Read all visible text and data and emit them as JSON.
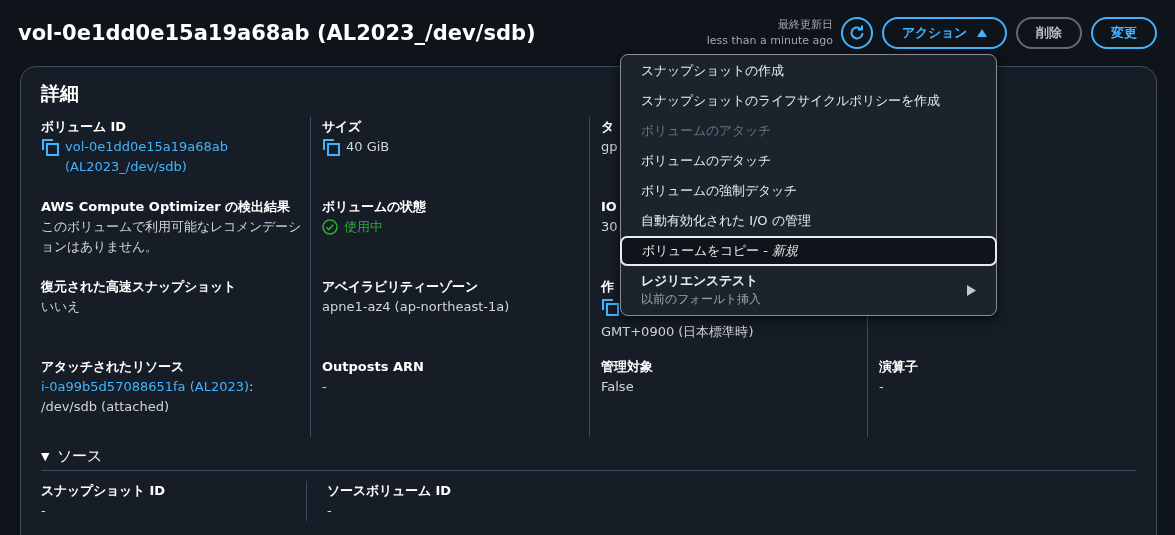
{
  "header": {
    "title": "vol-0e1dd0e15a19a68ab (AL2023_/dev/sdb)",
    "last_updated_label": "最終更新日",
    "last_updated_value": "less than a minute ago",
    "buttons": [
      {
        "label": "アクション",
        "kind": "dropdown",
        "expanded": true
      },
      {
        "label": "削除",
        "kind": "normal"
      },
      {
        "label": "変更",
        "kind": "primary"
      }
    ]
  },
  "details": {
    "heading": "詳細",
    "cells": [
      {
        "label": "ボリューム ID",
        "kind": "copy-link",
        "value": "vol-0e1dd0e15a19a68ab (AL2023_/dev/sdb)"
      },
      {
        "label": "サイズ",
        "kind": "copy-text",
        "value": "40 GiB"
      },
      {
        "label": "タ",
        "kind": "text",
        "value": "gp"
      },
      {
        "kind": "empty"
      },
      {
        "label": "AWS Compute Optimizer の検出結果",
        "kind": "text",
        "value": "このボリュームで利用可能なレコメンデーションはありません。"
      },
      {
        "label": "ボリュームの状態",
        "kind": "status",
        "value": "使用中"
      },
      {
        "label": "IO",
        "kind": "text",
        "value": "30"
      },
      {
        "kind": "empty"
      },
      {
        "label": "復元された高速スナップショット",
        "kind": "text",
        "value": "いいえ"
      },
      {
        "label": "アベイラビリティーゾーン",
        "kind": "text",
        "value": "apne1-az4 (ap-northeast-1a)"
      },
      {
        "label": "作",
        "kind": "copy-wrap",
        "value": "GMT+0900 (日本標準時)"
      },
      {
        "kind": "empty"
      },
      {
        "label": "アタッチされたリソース",
        "kind": "link-rest",
        "value": "i-0a99b5d57088651fa (AL2023)",
        "rest": ":",
        "rest2": "/dev/sdb (attached)"
      },
      {
        "label": "Outposts ARN",
        "kind": "text",
        "value": "-"
      },
      {
        "label": "管理対象",
        "kind": "text",
        "value": "False"
      },
      {
        "label": "演算子",
        "kind": "text",
        "value": "-"
      }
    ]
  },
  "source": {
    "toggle": "▼",
    "heading": "ソース",
    "expanded": true,
    "cells": [
      {
        "label": "スナップショット ID",
        "value": "-"
      },
      {
        "label": "ソースボリューム ID",
        "value": "-"
      }
    ]
  },
  "menu": {
    "items": [
      {
        "label": "スナップショットの作成",
        "kind": "item",
        "disabled": false,
        "selected": false
      },
      {
        "label": "スナップショットのライフサイクルポリシーを作成",
        "kind": "item",
        "disabled": false,
        "selected": false
      },
      {
        "label": "ボリュームのアタッチ",
        "kind": "item",
        "disabled": true,
        "selected": false
      },
      {
        "label": "ボリュームのデタッチ",
        "kind": "item",
        "disabled": false,
        "selected": false
      },
      {
        "label": "ボリュームの強制デタッチ",
        "kind": "item",
        "disabled": false,
        "selected": false
      },
      {
        "label": "自動有効化された I/O の管理",
        "kind": "item",
        "disabled": false,
        "selected": false
      },
      {
        "label": "ボリュームをコピー - *新規*",
        "kind": "item",
        "disabled": false,
        "selected": true
      },
      {
        "label": "レジリエンステスト",
        "sublabel": "以前のフォールト挿入",
        "kind": "submenu",
        "disabled": false,
        "selected": false
      }
    ]
  }
}
